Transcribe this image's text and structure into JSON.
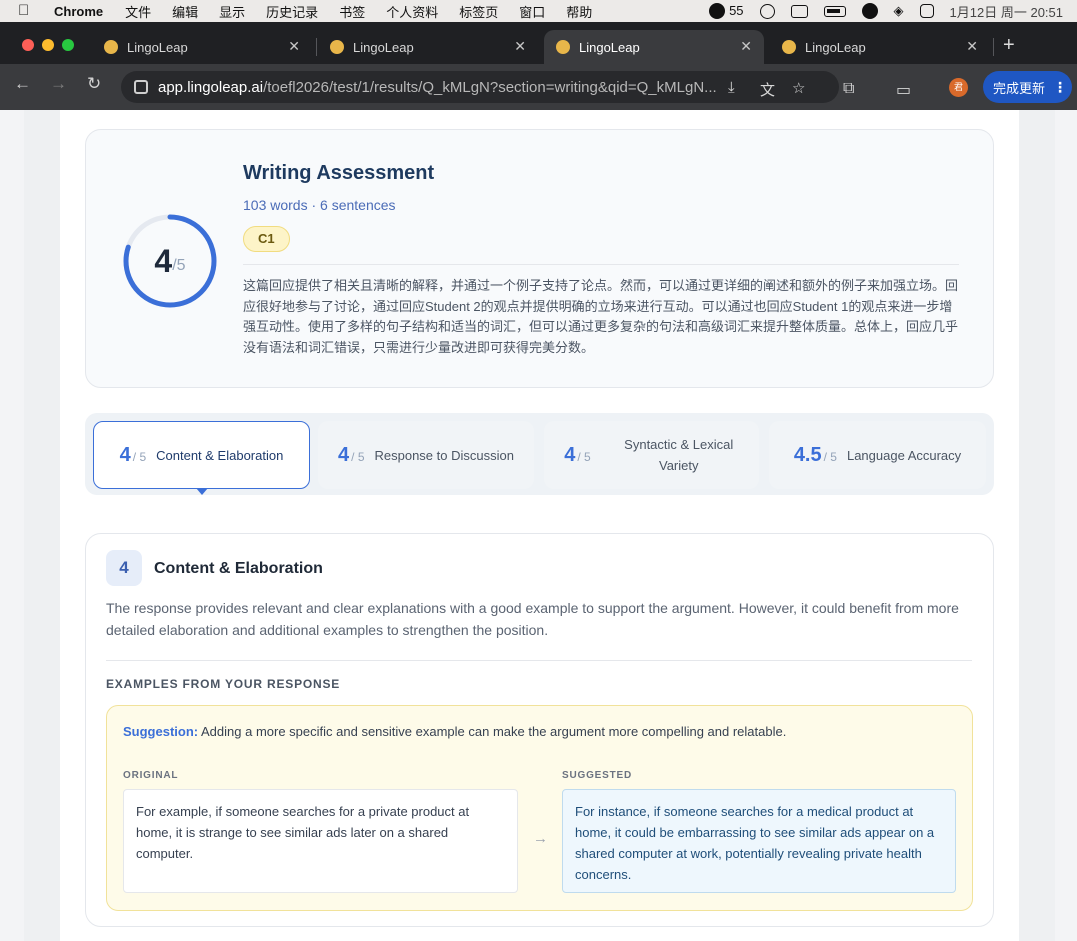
{
  "menubar": {
    "app": "Chrome",
    "items": [
      "文件",
      "编辑",
      "显示",
      "历史记录",
      "书签",
      "个人资料",
      "标签页",
      "窗口",
      "帮助"
    ],
    "wechat_count": "55",
    "datetime": "1月12日 周一  20:51"
  },
  "tabs": [
    {
      "title": "LingoLeap"
    },
    {
      "title": "LingoLeap"
    },
    {
      "title": "LingoLeap"
    },
    {
      "title": "LingoLeap"
    }
  ],
  "toolbar": {
    "url_host": "app.lingoleap.ai",
    "url_path": "/toefl2026/test/1/results/Q_kMLgN?section=writing&qid=Q_kMLgN...",
    "update_label": "完成更新",
    "avatar_text": "君"
  },
  "assessment": {
    "score": "4",
    "max": "/5",
    "score_fraction": 0.8,
    "title": "Writing Assessment",
    "meta": "103 words · 6 sentences",
    "level": "C1",
    "feedback": "这篇回应提供了相关且清晰的解释，并通过一个例子支持了论点。然而，可以通过更详细的阐述和额外的例子来加强立场。回应很好地参与了讨论，通过回应Student 2的观点并提供明确的立场来进行互动。可以通过也回应Student 1的观点来进一步增强互动性。使用了多样的句子结构和适当的词汇，但可以通过更多复杂的句法和高级词汇来提升整体质量。总体上，回应几乎没有语法和词汇错误，只需进行少量改进即可获得完美分数。"
  },
  "criteria": [
    {
      "score": "4",
      "max": "/ 5",
      "label": "Content & Elaboration"
    },
    {
      "score": "4",
      "max": "/ 5",
      "label": "Response to Discussion"
    },
    {
      "score": "4",
      "max": "/ 5",
      "label": "Syntactic & Lexical Variety"
    },
    {
      "score": "4.5",
      "max": "/ 5",
      "label": "Language Accuracy"
    }
  ],
  "detail": {
    "score": "4",
    "title": "Content & Elaboration",
    "description": "The response provides relevant and clear explanations with a good example to support the argument. However, it could benefit from more detailed elaboration and additional examples to strengthen the position.",
    "examples_heading": "EXAMPLES FROM YOUR RESPONSE",
    "suggestion_label": "Suggestion:",
    "suggestion_text": "Adding a more specific and sensitive example can make the argument more compelling and relatable.",
    "original_label": "ORIGINAL",
    "original_text": "For example, if someone searches for a private product at home, it is strange to see similar ads later on a shared computer.",
    "suggested_label": "SUGGESTED",
    "suggested_text": "For instance, if someone searches for a medical product at home, it could be embarrassing to see similar ads appear on a shared computer at work, potentially revealing private health concerns."
  },
  "colors": {
    "accent": "#3b6fd8",
    "ring_track": "#e5e9f0",
    "suggestion_bg": "#fefbe9",
    "suggested_bg": "#eef7fd"
  }
}
